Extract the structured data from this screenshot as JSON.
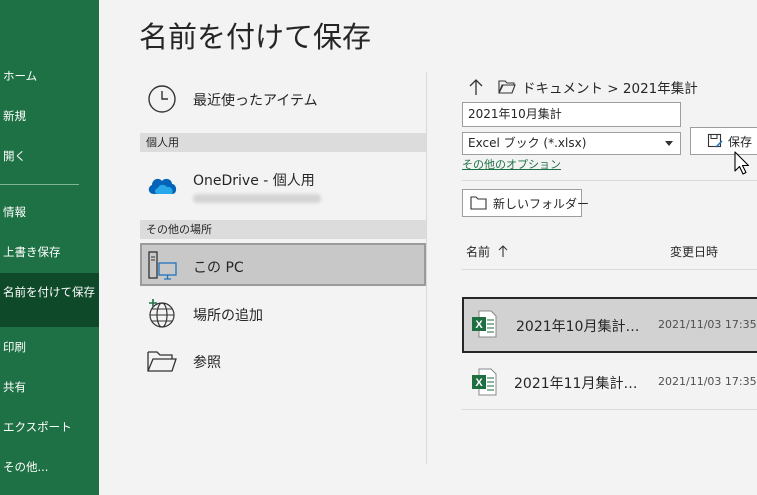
{
  "page_title": "名前を付けて保存",
  "sidebar": {
    "items": [
      {
        "label": "ホーム"
      },
      {
        "label": "新規"
      },
      {
        "label": "開く"
      },
      {
        "label": "情報"
      },
      {
        "label": "上書き保存"
      },
      {
        "label": "名前を付けて保存",
        "active": true
      },
      {
        "label": "印刷"
      },
      {
        "label": "共有"
      },
      {
        "label": "エクスポート"
      },
      {
        "label": "その他..."
      }
    ]
  },
  "locations": {
    "recent": "最近使ったアイテム",
    "personal_header": "個人用",
    "onedrive": "OneDrive - 個人用",
    "other_header": "その他の場所",
    "this_pc": "この PC",
    "add_place": "場所の追加",
    "browse": "参照"
  },
  "right": {
    "path": "ドキュメント > 2021年集計",
    "filename": "2021年10月集計",
    "filetype": "Excel ブック (*.xlsx)",
    "options_link": "その他のオプション",
    "save_label": "保存",
    "new_folder_label": "新しいフォルダー",
    "col_name": "名前",
    "col_date": "変更日時",
    "files": [
      {
        "name": "2021年10月集計…",
        "date": "2021/11/03 17:35",
        "selected": true
      },
      {
        "name": "2021年11月集計…",
        "date": "2021/11/03 17:35",
        "selected": false
      }
    ]
  },
  "colors": {
    "sidebar_bg": "#1e7145",
    "sidebar_active": "#0e4a2a",
    "accent": "#1e7145",
    "excel_green": "#1d6f42",
    "onedrive_blue": "#0364b8"
  }
}
